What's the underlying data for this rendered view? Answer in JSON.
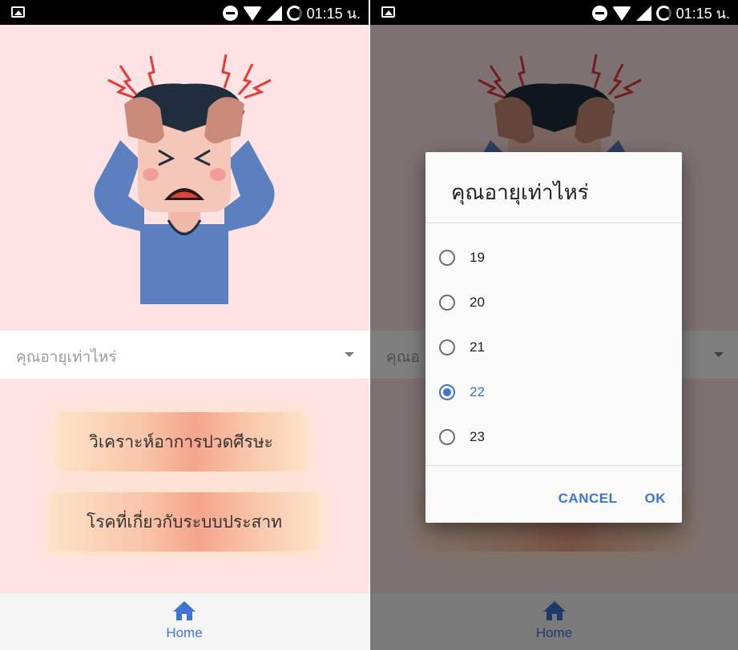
{
  "status_bar": {
    "time": "01:15 น.",
    "icons": [
      "gallery-icon",
      "dnd-icon",
      "wifi-icon",
      "signal-icon",
      "battery-icon"
    ]
  },
  "form": {
    "age_placeholder": "คุณอายุเท่าไหร่",
    "age_placeholder_partial": "คุณอ"
  },
  "buttons": {
    "analyze_headache": "วิเคราะห์อาการปวดศีรษะ",
    "nervous_diseases": "โรคที่เกี่ยวกับระบบประสาท"
  },
  "bottom_nav": {
    "home_label": "Home",
    "icon": "home-icon"
  },
  "dialog": {
    "title": "คุณอายุเท่าไหร่",
    "options": [
      {
        "label": "19",
        "checked": false
      },
      {
        "label": "20",
        "checked": false
      },
      {
        "label": "21",
        "checked": false
      },
      {
        "label": "22",
        "checked": true
      },
      {
        "label": "23",
        "checked": false
      }
    ],
    "cancel_label": "CANCEL",
    "ok_label": "OK"
  },
  "colors": {
    "background": "#fde3e3",
    "accent": "#3d74d6",
    "pill_center": "#f5a58c",
    "pill_edge": "#fde3c8"
  }
}
